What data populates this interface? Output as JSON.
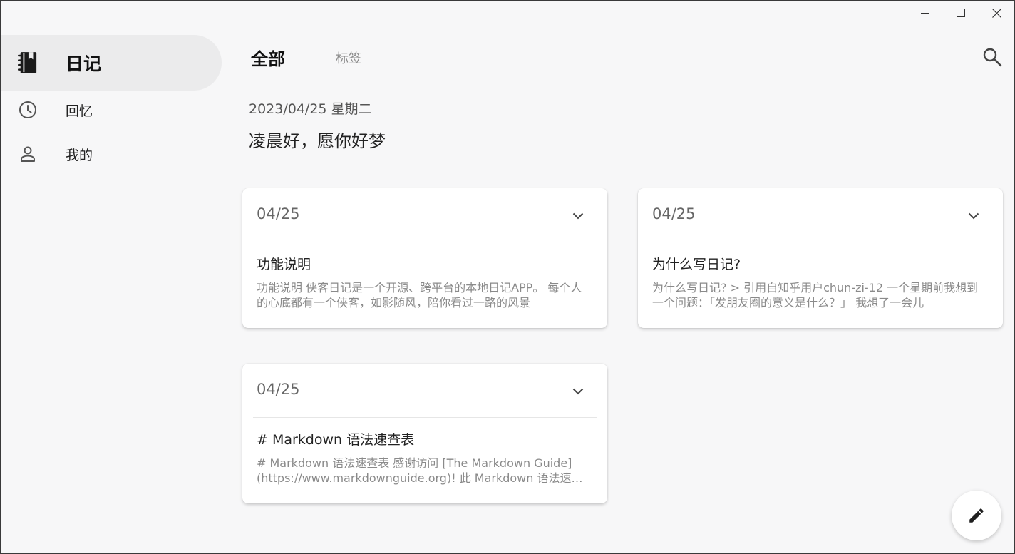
{
  "window": {
    "minimize_icon": "minimize-icon",
    "maximize_icon": "maximize-icon",
    "close_icon": "close-icon"
  },
  "sidebar": {
    "items": [
      {
        "label": "日记",
        "icon": "diary-book-icon",
        "active": true
      },
      {
        "label": "回忆",
        "icon": "clock-icon",
        "active": false
      },
      {
        "label": "我的",
        "icon": "person-icon",
        "active": false
      }
    ]
  },
  "header": {
    "tabs": [
      {
        "label": "全部",
        "active": true
      },
      {
        "label": "标签",
        "active": false
      }
    ],
    "search_icon": "search-icon"
  },
  "main": {
    "date": "2023/04/25 星期二",
    "greeting": "凌晨好，愿你好梦",
    "cards": [
      {
        "date": "04/25",
        "title": "功能说明",
        "excerpt": "功能说明 侠客日记是一个开源、跨平台的本地日记APP。 每个人的心底都有一个侠客，如影随风，陪你看过一路的风景"
      },
      {
        "date": "04/25",
        "title": "为什么写日记?",
        "excerpt": "为什么写日记?   > 引用自知乎用户chun-zi-12 一个星期前我想到一个问题：「发朋友圈的意义是什么？」 我想了一会儿"
      },
      {
        "date": "04/25",
        "title": "# Markdown 语法速查表",
        "excerpt": "# Markdown 语法速查表 感谢访问 [The Markdown Guide](https://www.markdownguide.org)! 此 Markdown 语法速查表提供了所有"
      }
    ]
  },
  "fab": {
    "icon": "pencil-icon"
  }
}
